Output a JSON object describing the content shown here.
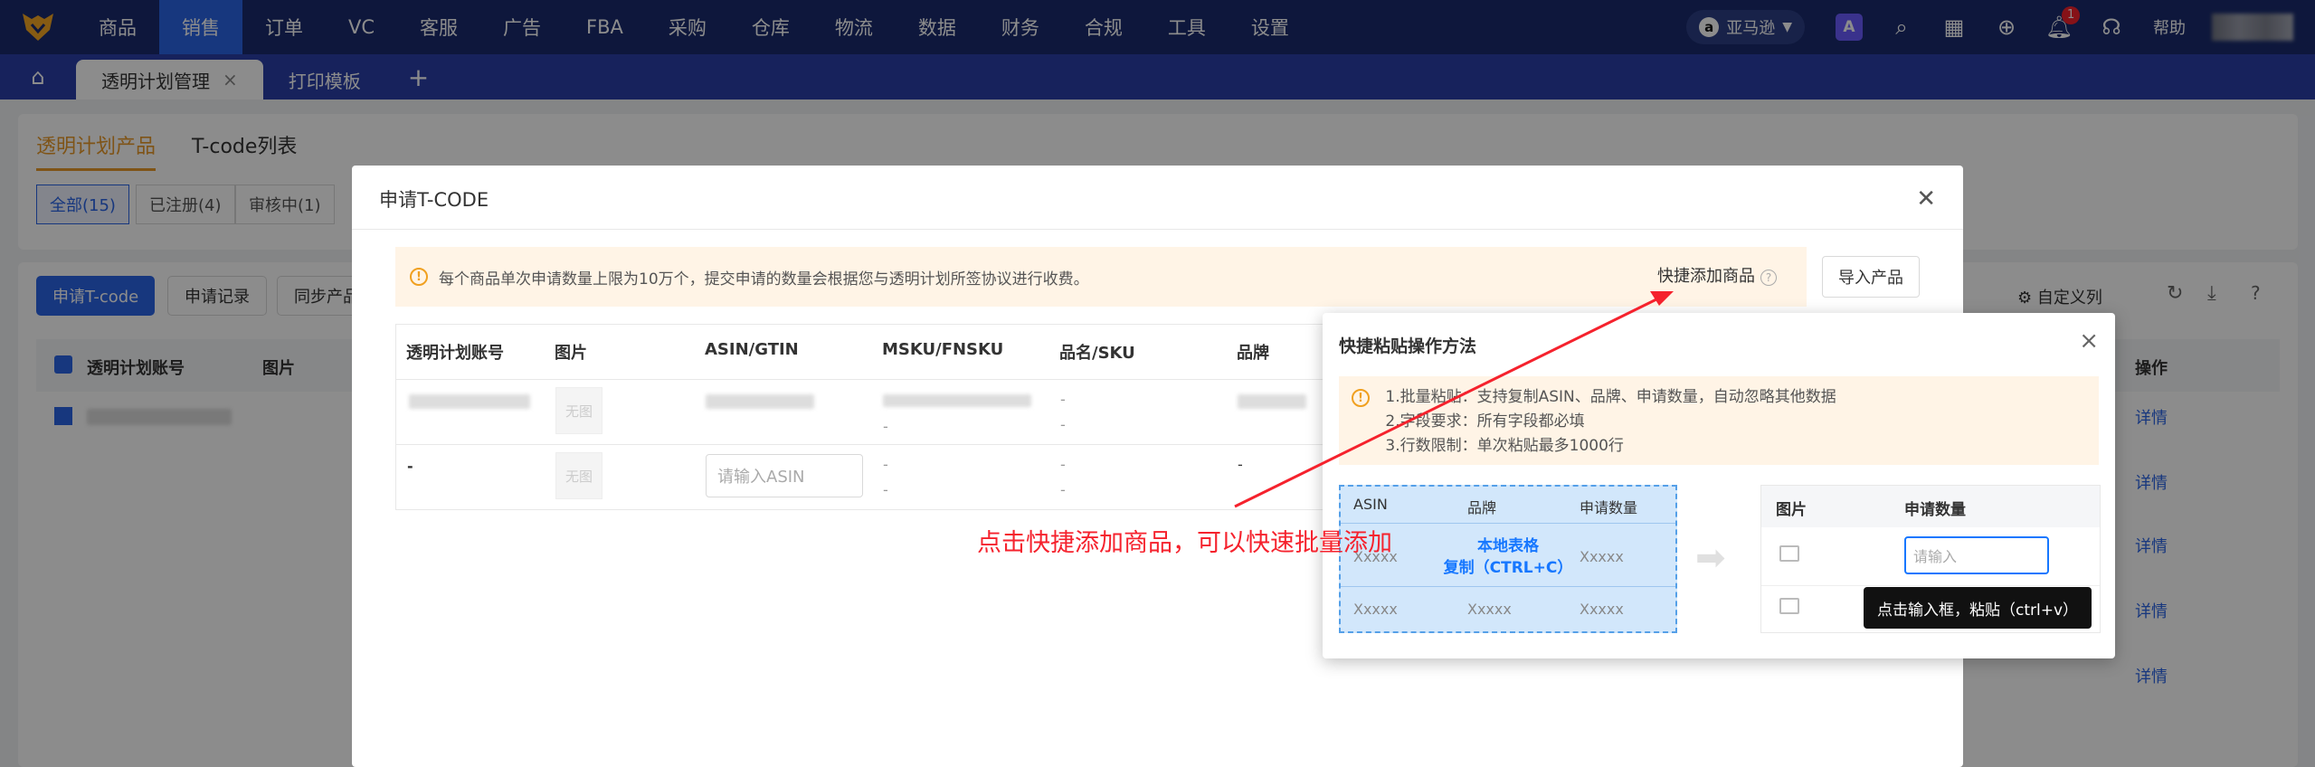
{
  "nav": {
    "items": [
      "商品",
      "销售",
      "订单",
      "VC",
      "客服",
      "广告",
      "FBA",
      "采购",
      "仓库",
      "物流",
      "数据",
      "财务",
      "合规",
      "工具",
      "设置"
    ],
    "active": "销售",
    "market": "亚马逊",
    "help": "帮助",
    "badge": "1",
    "icons": [
      "ai-icon",
      "search-icon",
      "grid-icon",
      "download-icon",
      "bell-icon",
      "headset-icon"
    ]
  },
  "tabs": {
    "items": [
      {
        "label": "透明计划管理",
        "active": true
      },
      {
        "label": "打印模板",
        "active": false
      }
    ],
    "add": "+"
  },
  "page": {
    "tabs": [
      "透明计划产品",
      "T-code列表"
    ],
    "filters": [
      "全部(15)",
      "已注册(4)",
      "审核中(1)"
    ],
    "buttons": [
      "申请T-code",
      "申请记录",
      "同步产品"
    ],
    "custom_cols": "自定义列",
    "headers": [
      "透明计划账号",
      "图片",
      "操作"
    ],
    "no_image": "无图",
    "detail": "详情"
  },
  "modal": {
    "title": "申请T-CODE",
    "warning": "每个商品单次申请数量上限为10万个，提交申请的数量会根据您与透明计划所签协议进行收费。",
    "quick_add": "快捷添加商品",
    "import": "导入产品",
    "columns": [
      "透明计划账号",
      "图片",
      "ASIN/GTIN",
      "MSKU/FNSKU",
      "品名/SKU",
      "品牌"
    ],
    "dash": "-",
    "no_image": "无图",
    "asin_placeholder": "请输入ASIN"
  },
  "popup": {
    "title": "快捷粘贴操作方法",
    "rules": [
      "1.批量粘贴：支持复制ASIN、品牌、申请数量，自动忽略其他数据",
      "2.字段要求：所有字段都必填",
      "3.行数限制：单次粘贴最多1000行"
    ],
    "local_headers": [
      "ASIN",
      "品牌",
      "申请数量"
    ],
    "local_cell": "Xxxxx",
    "local_overlay_1": "本地表格",
    "local_overlay_2": "复制（CTRL+C）",
    "target_headers": [
      "图片",
      "申请数量"
    ],
    "input_placeholder": "请输入",
    "tooltip": "点击输入框，粘贴（ctrl+v）"
  },
  "annotation": "点击快捷添加商品，可以快速批量添加",
  "colors": {
    "nav": "#1a2b6d",
    "accent": "#2a64e6",
    "orange": "#e89a2a",
    "annotation": "#f5222d"
  }
}
